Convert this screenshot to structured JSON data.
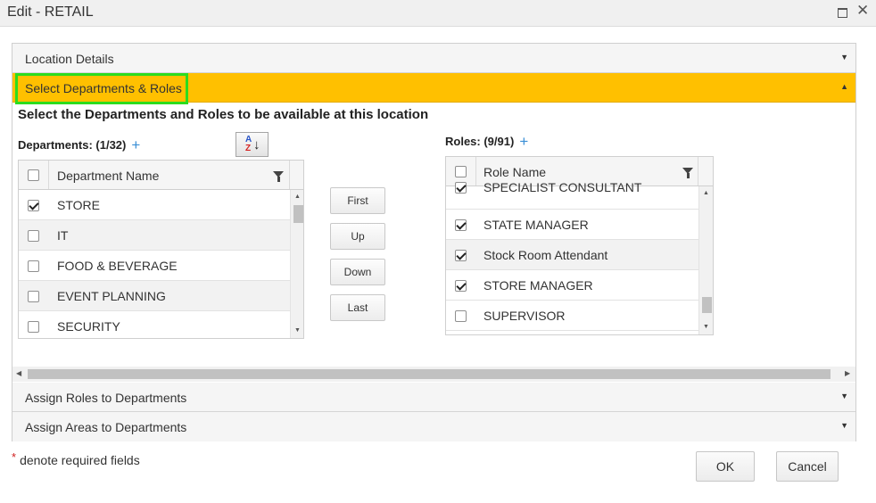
{
  "window": {
    "title": "Edit - RETAIL",
    "maximize_icon": "maximize-icon",
    "close_icon": "close-icon"
  },
  "accordion": {
    "sections": [
      {
        "label": "Location Details",
        "expanded": false
      },
      {
        "label": "Select Departments & Roles",
        "expanded": true
      },
      {
        "label": "Assign Roles to Departments",
        "expanded": false
      },
      {
        "label": "Assign Areas to Departments",
        "expanded": false
      }
    ]
  },
  "active_section": {
    "heading": "Select the Departments and Roles to be available at this location",
    "highlight_color": "#2cdc1d",
    "header_color": "#ffc000"
  },
  "departments": {
    "caption": "Departments: (1/32)",
    "column": "Department Name",
    "rows": [
      {
        "name": "STORE",
        "checked": true
      },
      {
        "name": "IT",
        "checked": false
      },
      {
        "name": "FOOD & BEVERAGE",
        "checked": false
      },
      {
        "name": "EVENT PLANNING",
        "checked": false
      },
      {
        "name": "SECURITY",
        "checked": false
      }
    ]
  },
  "roles": {
    "caption": "Roles: (9/91)",
    "column": "Role Name",
    "rows": [
      {
        "name": "SPECIALIST CONSULTANT",
        "checked": true
      },
      {
        "name": "STATE MANAGER",
        "checked": true
      },
      {
        "name": "Stock Room Attendant",
        "checked": true
      },
      {
        "name": "STORE MANAGER",
        "checked": true
      },
      {
        "name": "SUPERVISOR",
        "checked": false
      }
    ]
  },
  "move_buttons": {
    "first": "First",
    "up": "Up",
    "down": "Down",
    "last": "Last"
  },
  "footer": {
    "required_star": "*",
    "required_note": "denote required fields",
    "ok": "OK",
    "cancel": "Cancel"
  }
}
